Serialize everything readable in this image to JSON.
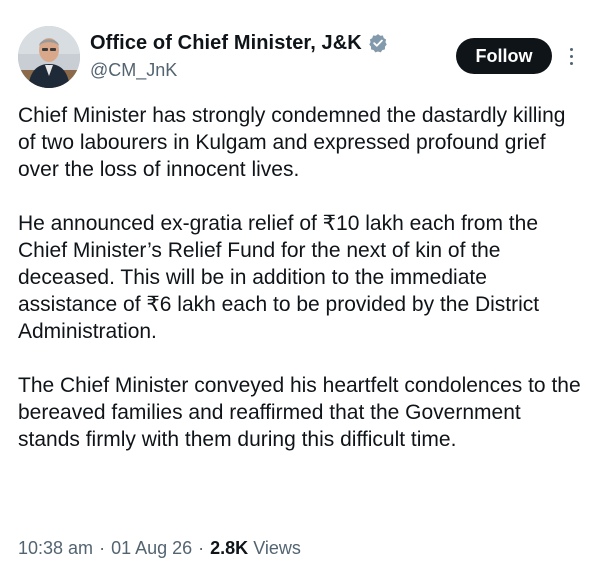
{
  "author": {
    "display_name": "Office of Chief Minister, J&K",
    "handle": "@CM_JnK",
    "verified": true,
    "avatar_icon": "profile-photo"
  },
  "actions": {
    "follow_label": "Follow",
    "more_icon": "more-vertical-icon"
  },
  "post": {
    "paragraphs": [
      "Chief Minister has strongly condemned the dastardly killing of two labourers in Kulgam and expressed profound grief over the loss of innocent lives.",
      "He announced ex-gratia relief of ₹10 lakh each from the Chief Minister’s Relief Fund for the next of kin of the deceased. This will be in addition to the immediate assistance of ₹6 lakh each to be provided by the District Administration.",
      "The Chief Minister conveyed his heartfelt condolences to the bereaved families and reaffirmed that the Government stands firmly with them during this difficult time."
    ]
  },
  "meta": {
    "time": "10:38 am",
    "separator": "·",
    "date": "01 Aug 26",
    "views_count": "2.8K",
    "views_label": "Views"
  },
  "colors": {
    "text_primary": "#0f1419",
    "text_secondary": "#536471",
    "verified_badge": "#829aab",
    "follow_bg": "#0f1419"
  }
}
